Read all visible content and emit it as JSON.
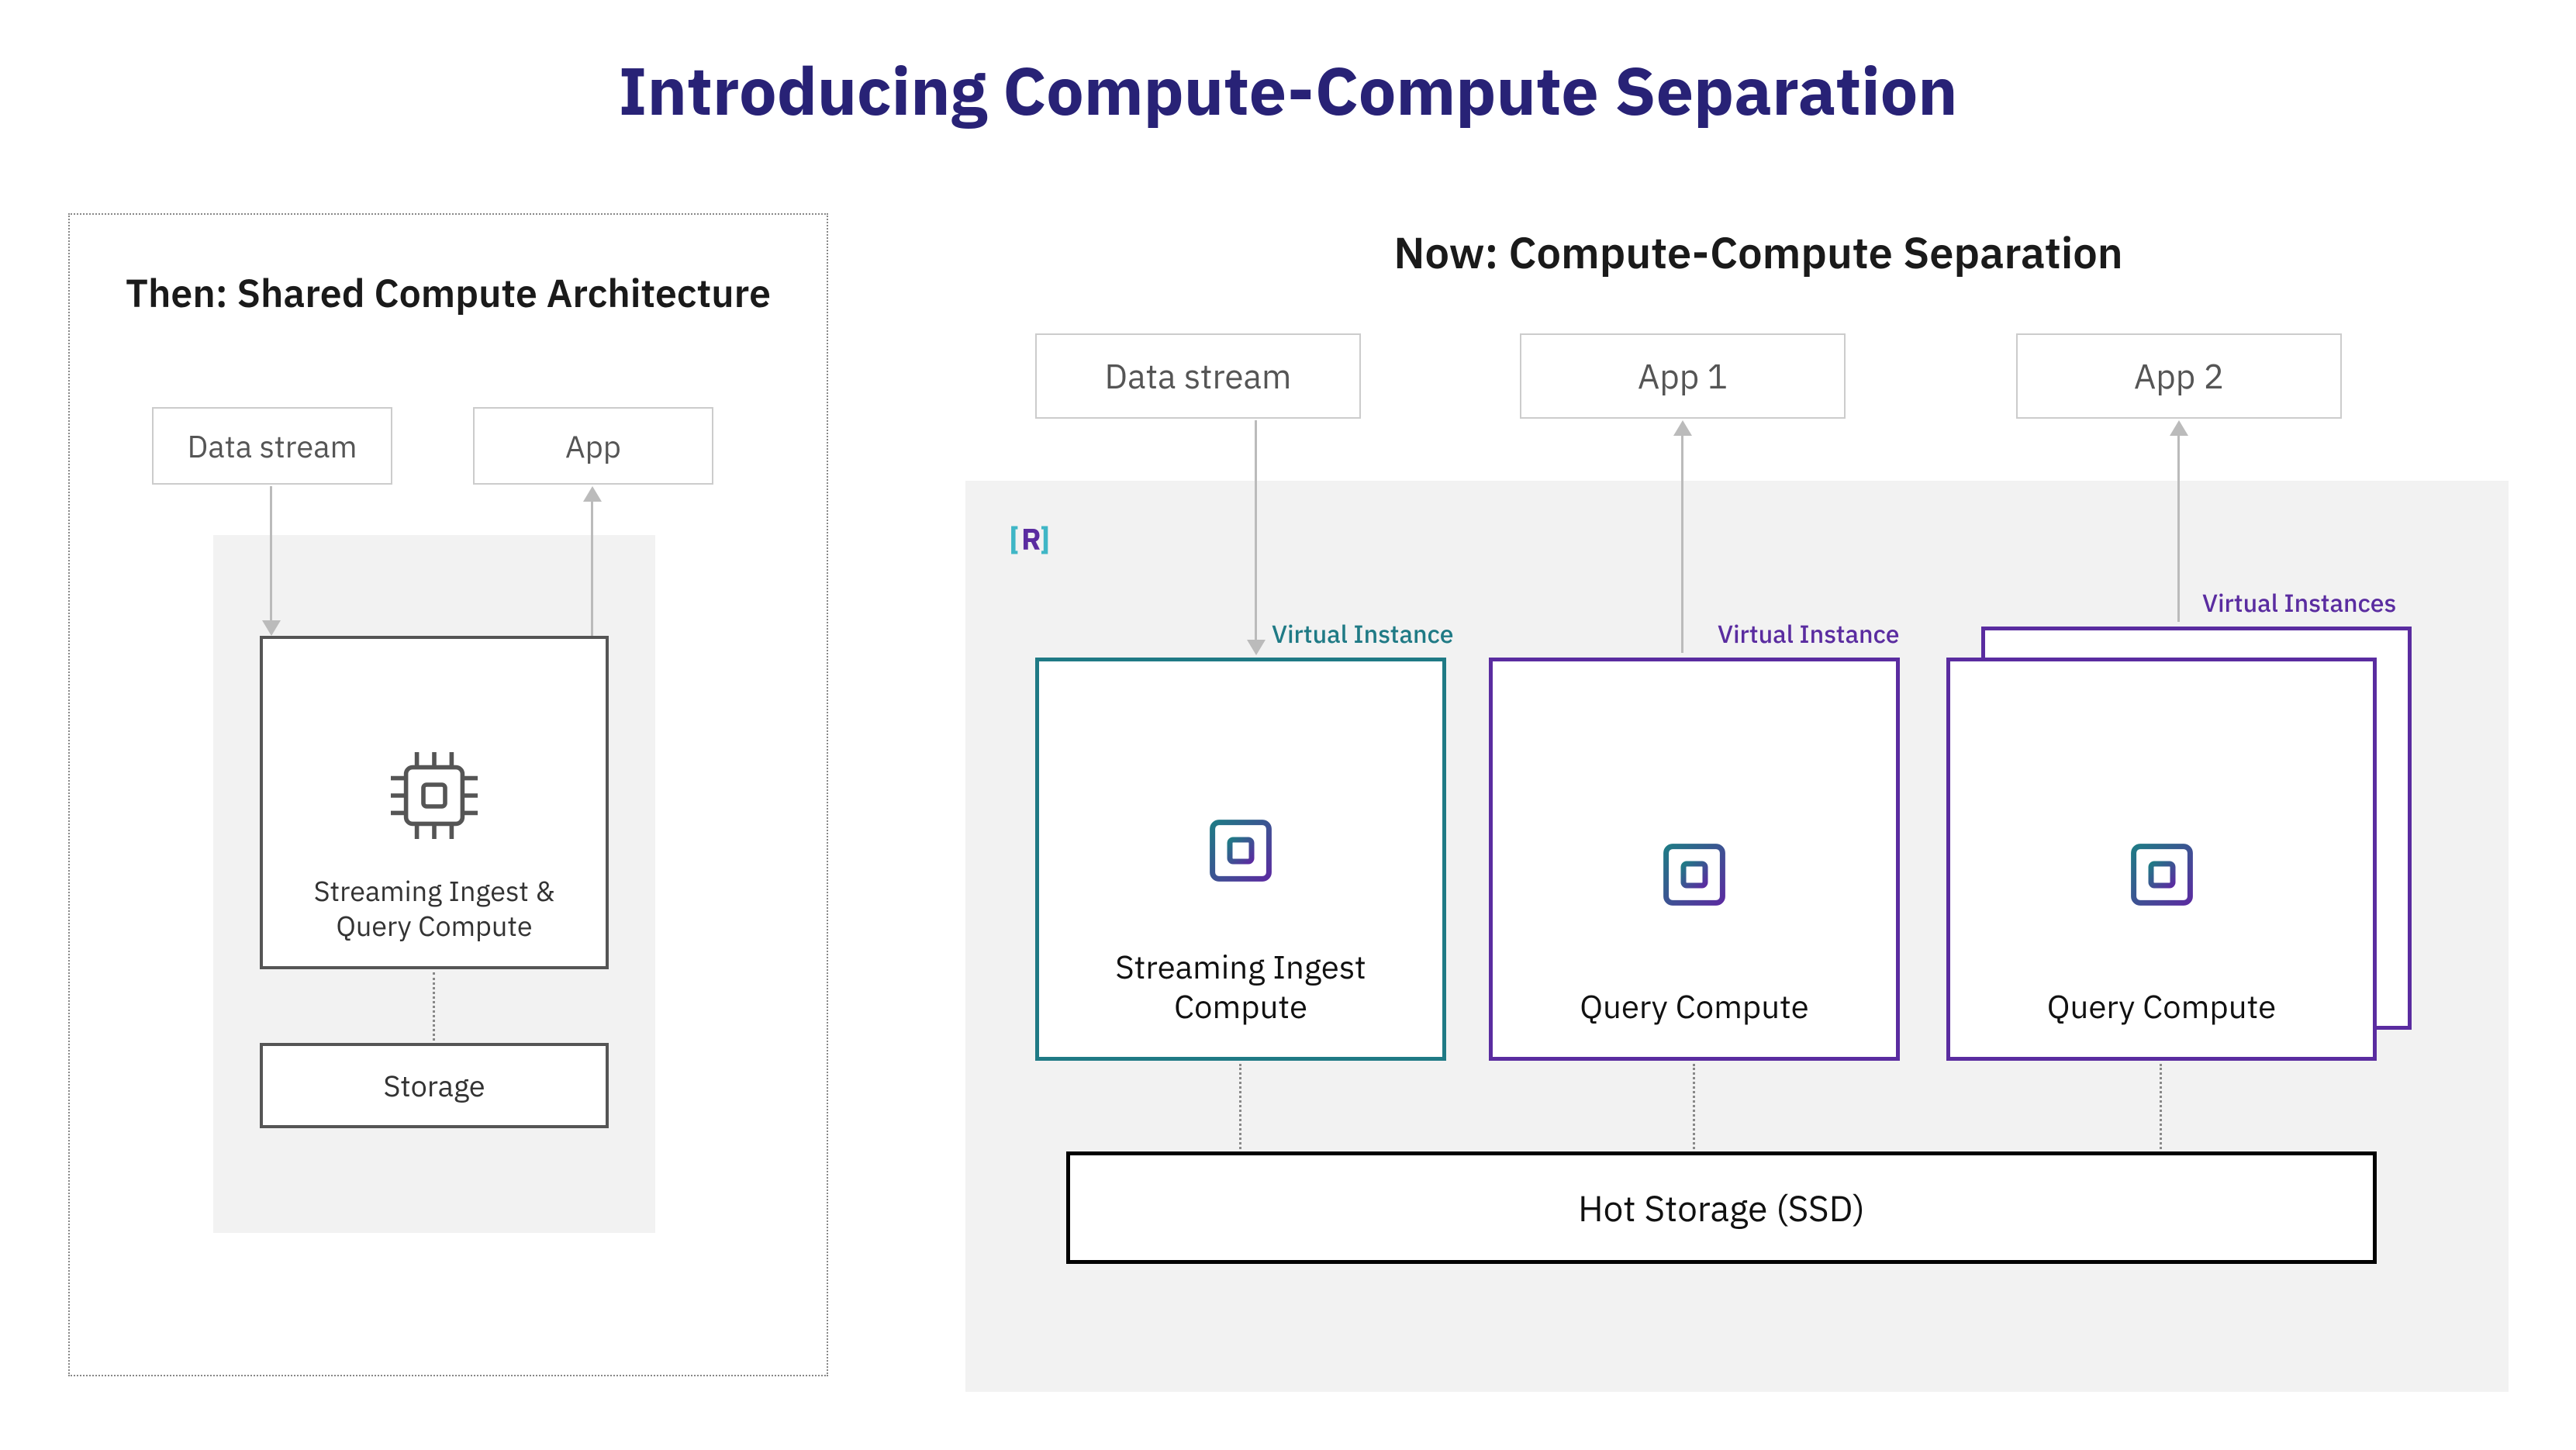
{
  "title": "Introducing Compute-Compute Separation",
  "then": {
    "heading": "Then: Shared Compute Architecture",
    "data_stream": "Data stream",
    "app": "App",
    "compute_label_1": "Streaming Ingest &",
    "compute_label_2": "Query Compute",
    "storage": "Storage"
  },
  "now": {
    "heading": "Now: Compute-Compute Separation",
    "data_stream": "Data stream",
    "app1": "App 1",
    "app2": "App 2",
    "vi_single": "Virtual Instance",
    "vi_plural": "Virtual Instances",
    "ingest_label_1": "Streaming Ingest",
    "ingest_label_2": "Compute",
    "query_label": "Query Compute",
    "hot_storage": "Hot Storage (SSD)"
  },
  "colors": {
    "title": "#282276",
    "teal": "#1f7a85",
    "purple": "#5a2ca0",
    "grey_border": "#555555"
  }
}
